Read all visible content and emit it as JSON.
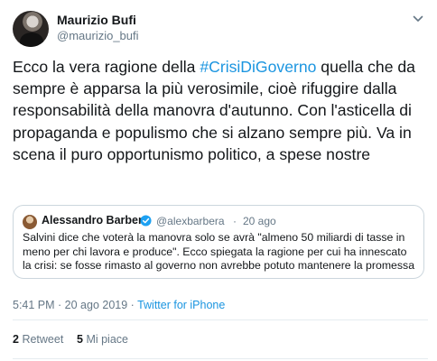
{
  "author": {
    "name": "Maurizio Bufi",
    "handle": "@maurizio_bufi"
  },
  "tweet": {
    "text_before": "Ecco la vera ragione della ",
    "hashtag": "#CrisiDiGoverno",
    "text_after": " quella che da sempre è apparsa la più verosimile, cioè rifuggire dalla responsabilità della manovra d'autunno. Con l'asticella di propaganda e populismo che si alzano sempre più. Va in scena il puro opportunismo politico, a spese nostre"
  },
  "quote": {
    "name": "Alessandro Barbera",
    "handle": "@alexbarbera",
    "separator": "·",
    "time": "20 ago",
    "text": "Salvini dice che voterà la manovra solo se avrà \"almeno 50 miliardi di tasse in meno per chi lavora e produce\". Ecco spiegata la ragione per cui ha innescato la crisi: se fosse rimasto al governo non avrebbe potuto mantenere la promessa"
  },
  "meta": {
    "timestamp": "5:41 PM · 20 ago 2019 · ",
    "source": "Twitter for iPhone"
  },
  "stats": {
    "retweets_count": "2",
    "retweets_label": "Retweet",
    "likes_count": "5",
    "likes_label": "Mi piace"
  },
  "icons": {
    "menu": "chevron-down-icon",
    "verified": "verified-badge-icon"
  },
  "colors": {
    "link": "#1b95e0",
    "secondary_text": "#657786",
    "border": "#ccd6dd"
  }
}
